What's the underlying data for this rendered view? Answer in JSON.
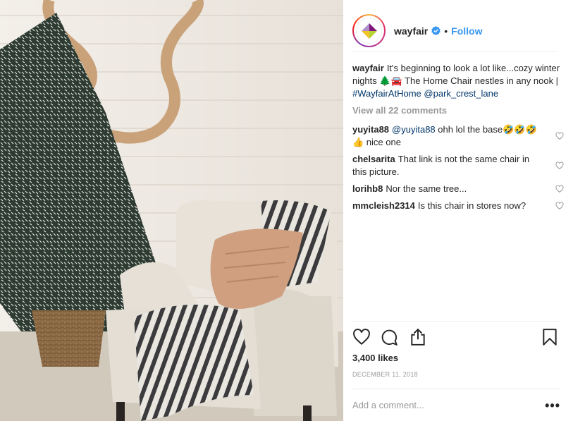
{
  "post": {
    "username": "wayfair",
    "follow_label": "Follow",
    "separator": "•",
    "caption": {
      "username": "wayfair",
      "text_1": "It's beginning to look a lot like...cozy winter nights ",
      "emoji": "🌲🚘",
      "text_2": " The Horne Chair nestles in any nook | ",
      "hashtag": "#WayfairAtHome",
      "mention": "@park_crest_lane"
    },
    "view_all_label": "View all 22 comments",
    "comments": [
      {
        "username": "yuyita88",
        "mention": "@yuyita88",
        "text": " ohh lol the base🤣🤣🤣👍 nice one"
      },
      {
        "username": "chelsarita",
        "text": "That link is not the same chair in this picture."
      },
      {
        "username": "lorihb8",
        "text": "Nor the same tree..."
      },
      {
        "username": "mmcleish2314",
        "text": "Is this chair in stores now?"
      }
    ],
    "likes": "3,400 likes",
    "date": "DECEMBER 11, 2018",
    "comment_placeholder": "Add a comment...",
    "more_label": "•••"
  },
  "colors": {
    "accent": "#3897f0",
    "link": "#003569",
    "muted": "#999999",
    "text": "#262626"
  },
  "icons": [
    "verified-badge-icon",
    "heart-icon",
    "comment-icon",
    "share-icon",
    "bookmark-icon",
    "more-options-icon"
  ]
}
